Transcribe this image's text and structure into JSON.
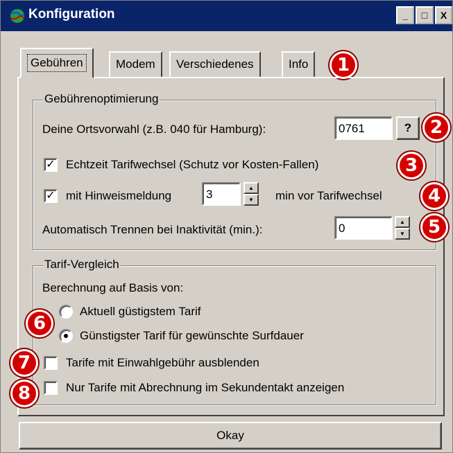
{
  "window": {
    "title": "Konfiguration",
    "minimize": "_",
    "maximize": "□",
    "close": "X"
  },
  "tabs": [
    {
      "label": "Gebühren",
      "active": true
    },
    {
      "label": "Modem"
    },
    {
      "label": "Verschiedenes"
    },
    {
      "label": "Info"
    }
  ],
  "fees": {
    "group_label": "Gebührenoptimierung",
    "area_code_label": "Deine Ortsvorwahl (z.B. 040 für Hamburg):",
    "area_code_value": "0761",
    "help_button": "?",
    "realtime_label": "Echtzeit Tarifwechsel (Schutz vor Kosten-Fallen)",
    "realtime_checked": true,
    "notice_label": "mit Hinweismeldung",
    "notice_checked": true,
    "notice_minutes": "3",
    "notice_suffix": "min vor Tarifwechsel",
    "auto_disconnect_label": "Automatisch Trennen bei Inaktivität (min.):",
    "auto_disconnect_value": "0"
  },
  "compare": {
    "group_label": "Tarif-Vergleich",
    "basis_label": "Berechnung auf Basis von:",
    "options": [
      {
        "label": "Aktuell güstigstem Tarif",
        "selected": false
      },
      {
        "label": "Günstigster Tarif für gewünschte Surfdauer",
        "selected": true
      }
    ],
    "hide_dialin_label": "Tarife mit Einwahlgebühr ausblenden",
    "hide_dialin_checked": false,
    "per_second_label": "Nur Tarife mit Abrechnung im Sekundentakt anzeigen",
    "per_second_checked": false
  },
  "okay_button": "Okay",
  "badges": [
    "1",
    "2",
    "3",
    "4",
    "5",
    "6",
    "7",
    "8"
  ],
  "checkmark": "✓",
  "colors": {
    "titlebar": "#0a246a",
    "face": "#d4d0c8",
    "badge": "#d40000"
  }
}
